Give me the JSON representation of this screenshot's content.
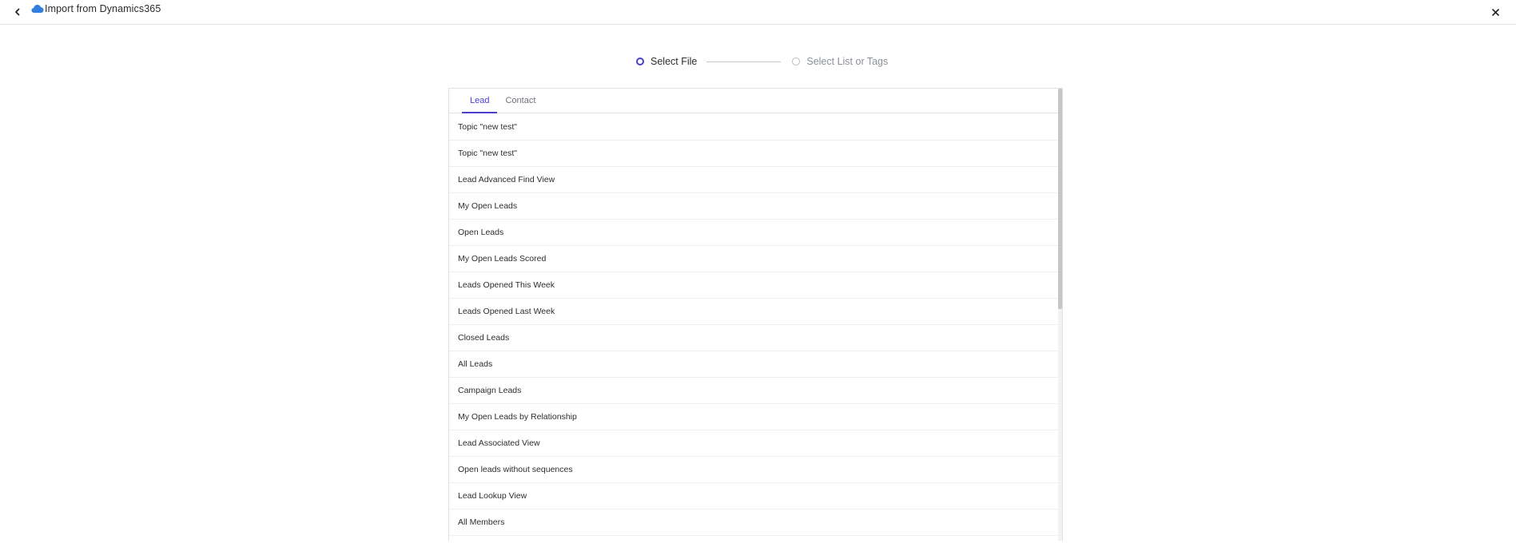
{
  "header": {
    "title": "Import from Dynamics365",
    "back_icon": "chevron-left-icon",
    "cloud_icon": "cloud-icon",
    "close_icon": "close-icon"
  },
  "stepper": {
    "steps": [
      {
        "label": "Select File",
        "state": "active"
      },
      {
        "label": "Select List or Tags",
        "state": "inactive"
      }
    ]
  },
  "tabs": [
    {
      "label": "Lead",
      "active": true
    },
    {
      "label": "Contact",
      "active": false
    }
  ],
  "list": {
    "items": [
      "Topic \"new test\"",
      "Topic \"new test\"",
      "Lead Advanced Find View",
      "My Open Leads",
      "Open Leads",
      "My Open Leads Scored",
      "Leads Opened This Week",
      "Leads Opened Last Week",
      "Closed Leads",
      "All Leads",
      "Campaign Leads",
      "My Open Leads by Relationship",
      "Lead Associated View",
      "Open leads without sequences",
      "Lead Lookup View",
      "All Members"
    ]
  },
  "colors": {
    "accent": "#4b3fcc",
    "cloud": "#2f7ee0",
    "border": "#e1e3e8"
  }
}
